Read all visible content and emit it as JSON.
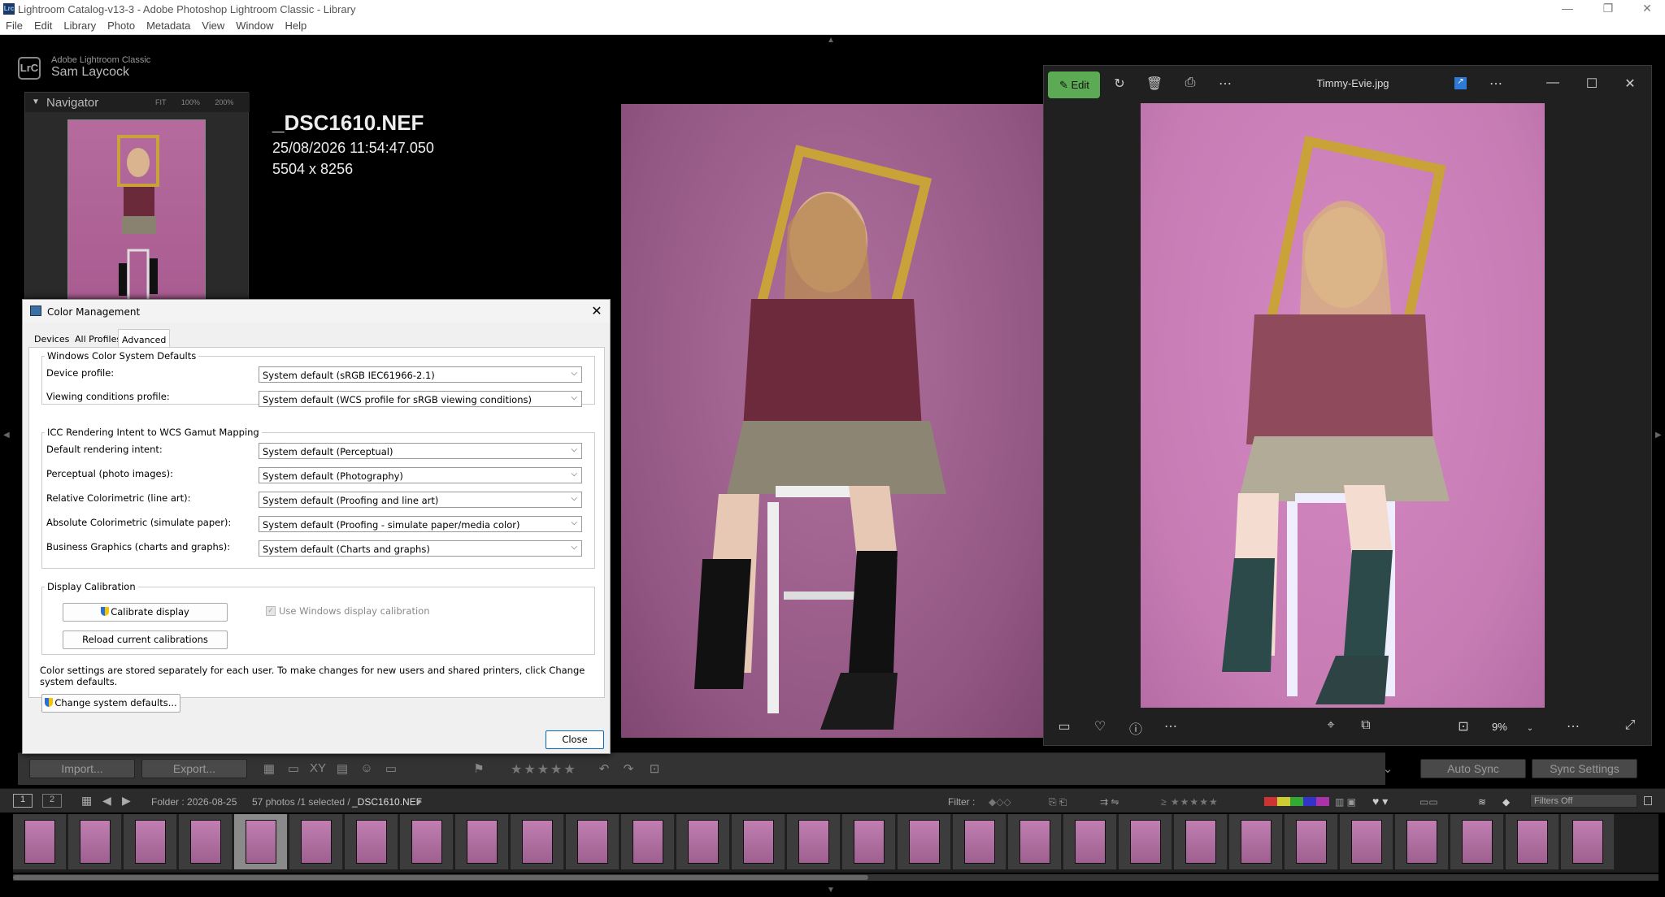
{
  "window": {
    "title": "Lightroom Catalog-v13-3 - Adobe Photoshop Lightroom Classic - Library",
    "app_icon": "Lrc"
  },
  "menu": [
    "File",
    "Edit",
    "Library",
    "Photo",
    "Metadata",
    "View",
    "Window",
    "Help"
  ],
  "identity": {
    "app_name": "Adobe Lightroom Classic",
    "user": "Sam Laycock",
    "logo": "LrC"
  },
  "navigator": {
    "title": "Navigator",
    "zoom_options": "FIT 100% 200%"
  },
  "photo_info": {
    "filename": "_DSC1610.NEF",
    "datetime": "25/08/2026 11:54:47.050",
    "dimensions": "5504 x 8256"
  },
  "toolbar": {
    "import_label": "Import...",
    "export_label": "Export...",
    "auto_sync": "Auto Sync",
    "sync_settings": "Sync Settings"
  },
  "filmstrip": {
    "folder": "Folder : 2026-08-25",
    "count": "57 photos /1 selected /",
    "selected_file": "_DSC1610.NEF",
    "filter_label": "Filter :",
    "filters_off": "Filters Off",
    "page1": "1",
    "page2": "2",
    "thumb_count": 29,
    "selected_index": 4,
    "scroll_fraction": 0.52
  },
  "photos_app": {
    "edit_label": "Edit",
    "file_title": "Timmy-Evie.jpg",
    "zoom": "9%"
  },
  "dialog": {
    "title": "Color Management",
    "tabs": [
      "Devices",
      "All Profiles",
      "Advanced"
    ],
    "active_tab": "Advanced",
    "group1": {
      "title": "Windows Color System Defaults",
      "rows": [
        {
          "label": "Device profile:",
          "value": "System default (sRGB IEC61966-2.1)"
        },
        {
          "label": "Viewing conditions profile:",
          "value": "System default (WCS profile for sRGB viewing conditions)"
        }
      ]
    },
    "group2": {
      "title": "ICC Rendering Intent to WCS Gamut Mapping",
      "rows": [
        {
          "label": "Default rendering intent:",
          "value": "System default (Perceptual)"
        },
        {
          "label": "Perceptual (photo images):",
          "value": "System default (Photography)"
        },
        {
          "label": "Relative Colorimetric (line art):",
          "value": "System default (Proofing and line art)"
        },
        {
          "label": "Absolute Colorimetric (simulate paper):",
          "value": "System default (Proofing - simulate paper/media color)"
        },
        {
          "label": "Business Graphics (charts and graphs):",
          "value": "System default (Charts and graphs)"
        }
      ]
    },
    "group3": {
      "title": "Display Calibration",
      "calibrate": "Calibrate display",
      "reload": "Reload current calibrations",
      "use_windows": "Use Windows display calibration"
    },
    "note": "Color settings are stored separately for each user. To make changes for new users and shared printers, click Change system defaults.",
    "change_defaults": "Change system defaults...",
    "close": "Close"
  }
}
